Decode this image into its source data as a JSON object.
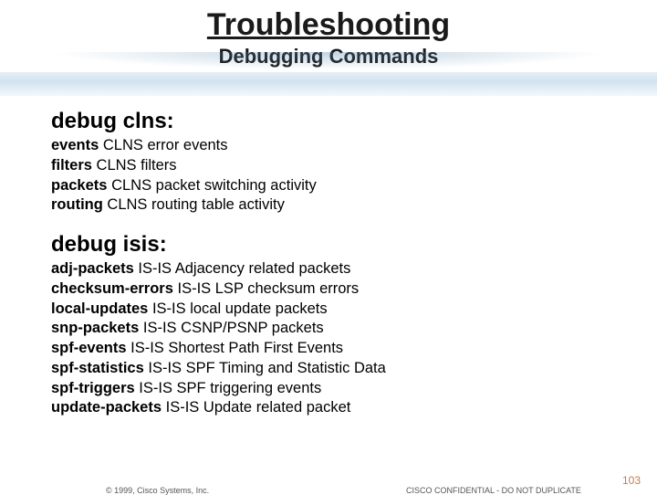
{
  "header": {
    "title": "Troubleshooting",
    "subtitle": "Debugging Commands"
  },
  "sections": [
    {
      "title": "debug clns:",
      "items": [
        {
          "k": "events",
          "d": "CLNS error events"
        },
        {
          "k": "filters",
          "d": "CLNS filters"
        },
        {
          "k": "packets",
          "d": "CLNS packet switching activity"
        },
        {
          "k": "routing",
          "d": "CLNS routing table activity"
        }
      ]
    },
    {
      "title": "debug isis:",
      "items": [
        {
          "k": "adj-packets",
          "d": "IS-IS Adjacency related packets"
        },
        {
          "k": "checksum-errors",
          "d": "IS-IS LSP checksum errors"
        },
        {
          "k": "local-updates",
          "d": "IS-IS local update packets"
        },
        {
          "k": "snp-packets",
          "d": "IS-IS CSNP/PSNP packets"
        },
        {
          "k": "spf-events",
          "d": "IS-IS Shortest Path First Events"
        },
        {
          "k": "spf-statistics",
          "d": "IS-IS SPF Timing and Statistic Data"
        },
        {
          "k": "spf-triggers",
          "d": "IS-IS SPF triggering events"
        },
        {
          "k": "update-packets",
          "d": "IS-IS Update related packet"
        }
      ]
    }
  ],
  "footer": {
    "copyright": "© 1999, Cisco Systems, Inc.",
    "confidential": "CISCO CONFIDENTIAL - DO NOT DUPLICATE",
    "page": "103"
  }
}
